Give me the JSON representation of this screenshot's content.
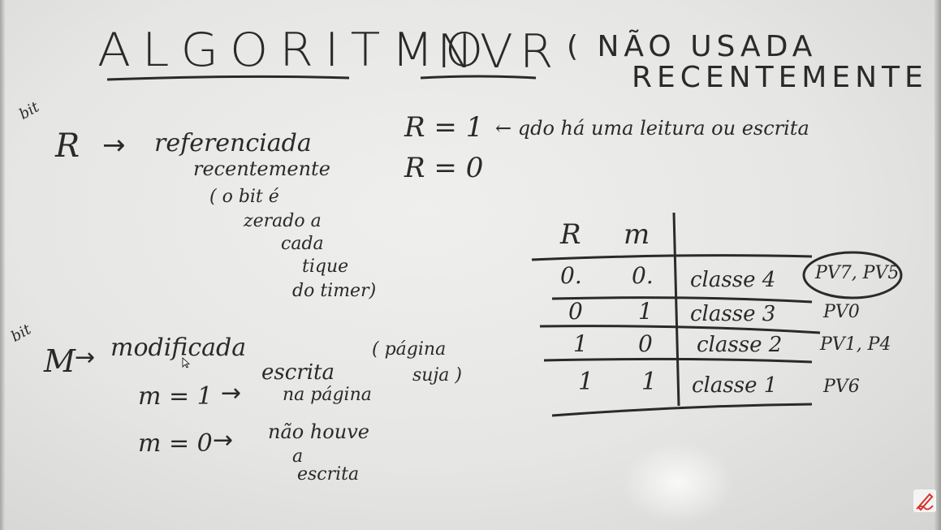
{
  "title": {
    "main": "ALGORITMO",
    "acronym": "NVR",
    "paren_line1": "( NÃO USADA",
    "paren_line2": "RECENTEMENTE )"
  },
  "r_bit": {
    "tag": "bit",
    "symbol": "R",
    "arrow": "→",
    "meaning_line1": "referenciada",
    "meaning_line2": "recentemente",
    "note_line1": "( o bit é",
    "note_line2": "zerado a",
    "note_line3": "cada",
    "note_line4": "tique",
    "note_line5": "do timer)",
    "r1": "R = 1",
    "r1_note": "← qdo há uma leitura ou escrita",
    "r0": "R = 0"
  },
  "m_bit": {
    "tag": "bit",
    "symbol": "M",
    "arrow": "→",
    "meaning": "modificada",
    "m1": "m = 1",
    "m1_arrow": "→",
    "m1_text_line1": "escrita",
    "m1_text_line2": "na página",
    "m1_paren_line1": "( página",
    "m1_paren_line2": "suja )",
    "m0": "m = 0",
    "m0_arrow": "→",
    "m0_text_line1": "não houve",
    "m0_text_line2": "a",
    "m0_text_line3": "escrita"
  },
  "table": {
    "headers": [
      "R",
      "m"
    ],
    "rows": [
      {
        "r": "0.",
        "m": "0.",
        "classe": "classe 4",
        "pages": "PV7, PV5"
      },
      {
        "r": "0",
        "m": "1",
        "classe": "classe 3",
        "pages": "PV0"
      },
      {
        "r": "1",
        "m": "0",
        "classe": "classe 2",
        "pages": "PV1, P4"
      },
      {
        "r": "1",
        "m": "1",
        "classe": "classe 1",
        "pages": "PV6"
      }
    ]
  },
  "icons": [
    "pen-icon",
    "cursor-icon"
  ],
  "colors": {
    "ink": "#2a2a2a",
    "board": "#ececea",
    "pen_icon": "#d9302a"
  }
}
